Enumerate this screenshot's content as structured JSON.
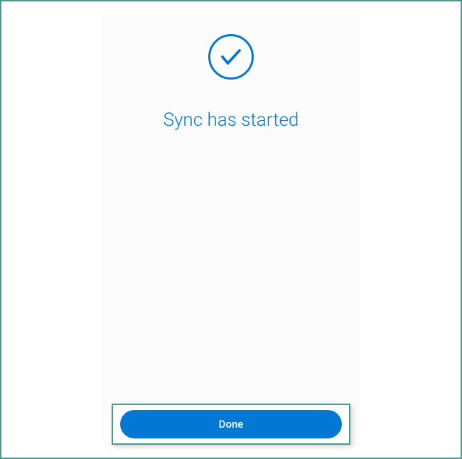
{
  "status": {
    "message": "Sync has started",
    "icon_name": "checkmark"
  },
  "actions": {
    "done_label": "Done"
  },
  "colors": {
    "accent": "#0078d4",
    "frame": "#4a9b8e"
  }
}
